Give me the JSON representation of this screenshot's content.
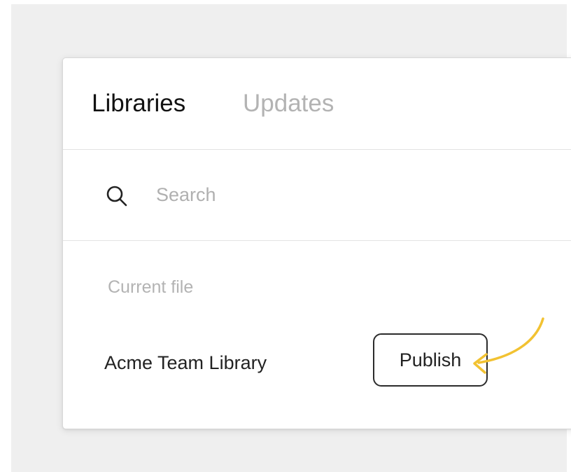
{
  "tabs": [
    {
      "label": "Libraries",
      "active": true
    },
    {
      "label": "Updates",
      "active": false
    }
  ],
  "search": {
    "value": "",
    "placeholder": "Search",
    "icon": "search-icon"
  },
  "section": {
    "label": "Current file"
  },
  "library": {
    "name": "Acme Team Library",
    "action_label": "Publish"
  },
  "annotation": {
    "icon": "curved-arrow-icon",
    "color": "#f2c232"
  },
  "colors": {
    "backdrop": "#efefef",
    "active_tab": "#111111",
    "inactive_tab": "#b3b3b3"
  }
}
